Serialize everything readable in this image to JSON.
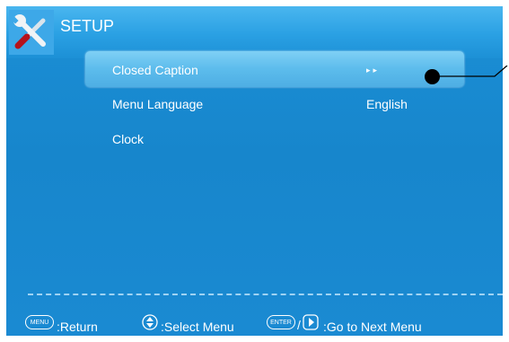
{
  "header": {
    "title": "SETUP",
    "icon": "tools-icon"
  },
  "menu": {
    "items": [
      {
        "label": "Closed Caption",
        "value": "▸▸",
        "selected": true
      },
      {
        "label": "Menu Language",
        "value": "English",
        "selected": false
      },
      {
        "label": "Clock",
        "value": "",
        "selected": false
      }
    ]
  },
  "footer": {
    "return_key": "MENU",
    "return_label": ":Return",
    "select_label": ":Select Menu",
    "enter_key": "ENTER",
    "next_label": ":Go to Next Menu"
  },
  "colors": {
    "background": "#1786cc",
    "titlebar": "#2aa0e3",
    "highlight": "#5cbcec",
    "text": "#ffffff"
  }
}
